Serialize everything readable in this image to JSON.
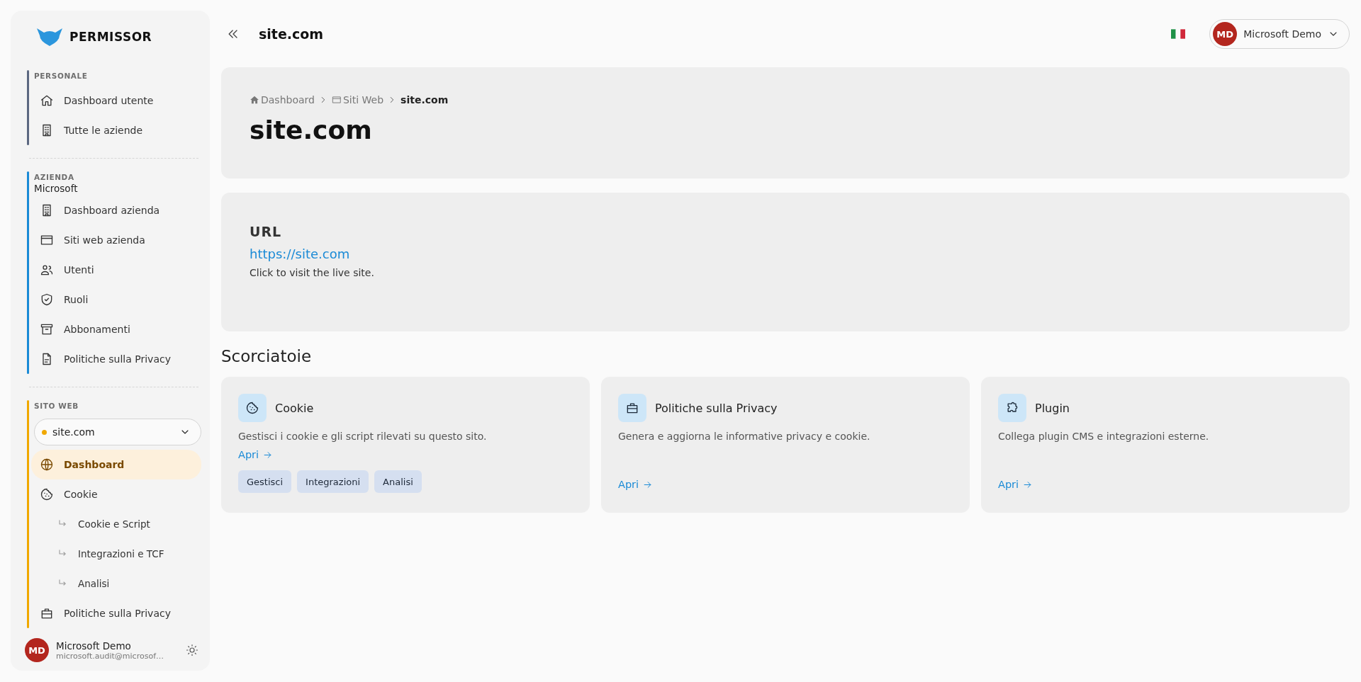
{
  "sidebar": {
    "logo": "PERMISSOR",
    "sections": [
      {
        "label": "PERSONALE",
        "color": "#5b6780",
        "items": [
          {
            "label": "Dashboard utente",
            "selected": false
          },
          {
            "label": "Tutte le aziende",
            "selected": false
          }
        ]
      },
      {
        "label": "AZIENDA",
        "subtitle": "Microsoft",
        "color": "#1a8ad6",
        "items": [
          {
            "label": "Dashboard azienda",
            "selected": false
          },
          {
            "label": "Siti web azienda",
            "selected": false
          },
          {
            "label": "Utenti",
            "selected": false
          },
          {
            "label": "Ruoli",
            "selected": false
          },
          {
            "label": "Abbonamenti",
            "selected": false
          },
          {
            "label": "Politiche sulla Privacy",
            "selected": false
          }
        ]
      },
      {
        "label": "SITO WEB",
        "color": "#f0a800",
        "site_select": {
          "value": "site.com"
        },
        "items": [
          {
            "label": "Dashboard",
            "selected": true
          },
          {
            "label": "Cookie",
            "selected": false,
            "children": [
              {
                "label": "Cookie e Script",
                "selected": false
              },
              {
                "label": "Integrazioni e TCF",
                "selected": false
              },
              {
                "label": "Analisi",
                "selected": false
              }
            ]
          },
          {
            "label": "Politiche sulla Privacy",
            "selected": false
          }
        ]
      }
    ],
    "user": {
      "initials": "MD",
      "name": "Microsoft Demo",
      "email": "microsoft.audit@microsof…"
    }
  },
  "header": {
    "title": "site.com",
    "user": {
      "initials": "MD",
      "name": "Microsoft Demo"
    }
  },
  "hero": {
    "breadcrumbs": [
      {
        "label": "Dashboard",
        "current": false
      },
      {
        "label": "Siti Web",
        "current": false
      },
      {
        "label": "site.com",
        "current": true
      }
    ],
    "title": "site.com"
  },
  "url_card": {
    "label": "URL",
    "link": "https://site.com",
    "description": "Click to visit the live site."
  },
  "shortcuts": {
    "title": "Scorciatoie",
    "cards": [
      {
        "title": "Cookie",
        "description": "Gestisci i cookie e gli script rilevati su questo sito.",
        "link": "Apri",
        "tags": [
          "Gestisci",
          "Integrazioni",
          "Analisi"
        ]
      },
      {
        "title": "Politiche sulla Privacy",
        "description": "Genera e aggiorna le informative privacy e cookie.",
        "link": "Apri"
      },
      {
        "title": "Plugin",
        "description": "Collega plugin CMS e integrazioni esterne.",
        "link": "Apri"
      }
    ]
  }
}
